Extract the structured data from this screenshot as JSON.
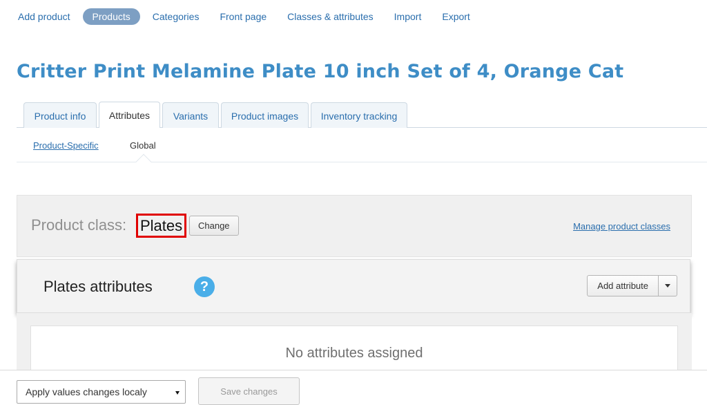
{
  "nav": {
    "items": [
      {
        "label": "Add product"
      },
      {
        "label": "Products",
        "active": true
      },
      {
        "label": "Categories"
      },
      {
        "label": "Front page"
      },
      {
        "label": "Classes & attributes"
      },
      {
        "label": "Import"
      },
      {
        "label": "Export"
      }
    ]
  },
  "page": {
    "title": "Critter Print Melamine Plate 10 inch Set of 4, Orange Cat"
  },
  "tabs": [
    {
      "label": "Product info"
    },
    {
      "label": "Attributes",
      "active": true
    },
    {
      "label": "Variants"
    },
    {
      "label": "Product images"
    },
    {
      "label": "Inventory tracking"
    }
  ],
  "subtabs": [
    {
      "label": "Product-Specific"
    },
    {
      "label": "Global",
      "active": true
    }
  ],
  "product_class": {
    "label": "Product class:",
    "value": "Plates",
    "change_label": "Change",
    "manage_label": "Manage product classes"
  },
  "attributes": {
    "title": "Plates attributes",
    "help_icon": "question-circle-icon",
    "help_glyph": "?",
    "add_label": "Add attribute",
    "empty_text": "No attributes assigned"
  },
  "footer": {
    "apply_select_value": "Apply values changes localy",
    "save_label": "Save changes"
  },
  "colors": {
    "accent": "#3e8dc6",
    "link": "#2a6ead",
    "nav_active_bg": "#7d9fc3",
    "highlight_border": "#e00000",
    "help_icon": "#4aaee8"
  }
}
